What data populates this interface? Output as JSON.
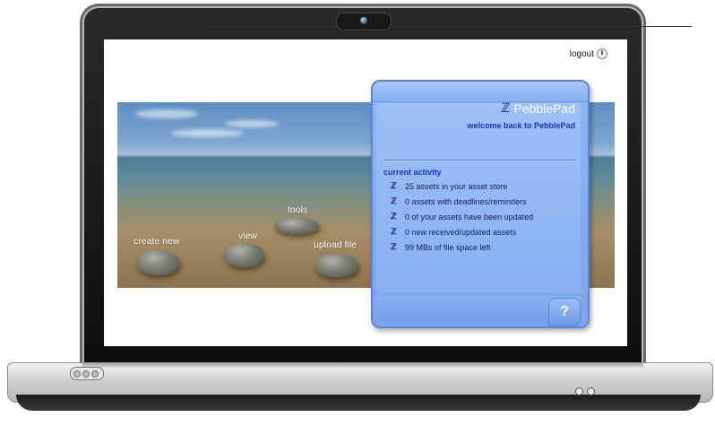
{
  "header": {
    "logout_label": "logout",
    "logout_icon": "power-icon"
  },
  "scene": {
    "stones": [
      {
        "label": "create new"
      },
      {
        "label": "view"
      },
      {
        "label": "tools"
      },
      {
        "label": "upload file"
      }
    ]
  },
  "panel": {
    "brand": "PebblePad",
    "brand_icon": "pebblepad-logo-icon",
    "welcome": "welcome back to PebblePad",
    "section_title": "current activity",
    "items": [
      {
        "text": "25 assets in your asset store"
      },
      {
        "text": "0 assets with deadlines/reminders"
      },
      {
        "text": "0 of your assets have been updated"
      },
      {
        "text": "0 new received/updated assets"
      },
      {
        "text": "99 MBs of file space left"
      }
    ],
    "help_label": "?"
  },
  "colors": {
    "panel_blue": "#7aa5ee",
    "heading_blue": "#1334b8"
  }
}
